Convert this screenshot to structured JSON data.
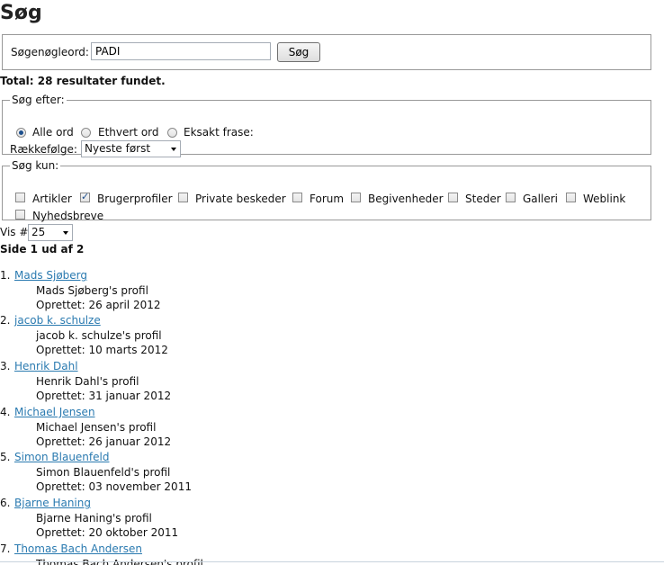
{
  "page": {
    "title": "Søg"
  },
  "search": {
    "label": "Søgenøgleord:",
    "value": "PADI",
    "button_label": "Søg"
  },
  "total_text": "Total: 28 resultater fundet.",
  "search_for": {
    "legend": "Søg efter:",
    "options": [
      {
        "label": "Alle ord",
        "checked": true
      },
      {
        "label": "Ethvert ord",
        "checked": false
      },
      {
        "label": "Eksakt frase:",
        "checked": false
      }
    ],
    "order_label": "Rækkefølge:",
    "order_value": "Nyeste først"
  },
  "search_only": {
    "legend": "Søg kun:",
    "options": [
      {
        "label": "Artikler",
        "checked": false
      },
      {
        "label": "Brugerprofiler",
        "checked": true
      },
      {
        "label": "Private beskeder",
        "checked": false
      },
      {
        "label": "Forum",
        "checked": false
      },
      {
        "label": "Begivenheder",
        "checked": false
      },
      {
        "label": "Steder",
        "checked": false
      },
      {
        "label": "Galleri",
        "checked": false
      },
      {
        "label": "Weblink",
        "checked": false
      },
      {
        "label": "Nyhedsbreve",
        "checked": false
      }
    ]
  },
  "show": {
    "label": "Vis #",
    "value": "25"
  },
  "page_info": "Side 1 ud af 2",
  "results": [
    {
      "num": "1.",
      "name": "Mads Sjøberg",
      "desc": "Mads Sjøberg's profil",
      "date": "Oprettet: 26 april 2012"
    },
    {
      "num": "2.",
      "name": "jacob k. schulze",
      "desc": "jacob k. schulze's profil",
      "date": "Oprettet: 10 marts 2012"
    },
    {
      "num": "3.",
      "name": "Henrik Dahl",
      "desc": "Henrik Dahl's profil",
      "date": "Oprettet: 31 januar 2012"
    },
    {
      "num": "4.",
      "name": "Michael Jensen",
      "desc": "Michael Jensen's profil",
      "date": "Oprettet: 26 januar 2012"
    },
    {
      "num": "5.",
      "name": "Simon Blauenfeld",
      "desc": "Simon Blauenfeld's profil",
      "date": "Oprettet: 03 november 2011"
    },
    {
      "num": "6.",
      "name": "Bjarne Haning",
      "desc": "Bjarne Haning's profil",
      "date": "Oprettet: 20 oktober 2011"
    },
    {
      "num": "7.",
      "name": "Thomas Bach Andersen",
      "desc": "Thomas Bach Andersen's profil",
      "date": ""
    }
  ],
  "colors": {
    "link": "#2a7ab0",
    "border": "#999999"
  }
}
